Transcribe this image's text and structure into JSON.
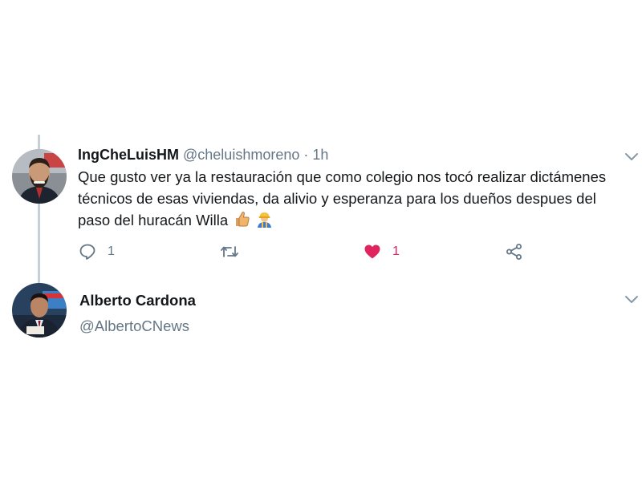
{
  "tweet": {
    "display_name": "IngCheLuisHM",
    "handle": "@cheluishmoreno",
    "separator": "·",
    "time": "1h",
    "text": "Que gusto ver ya la restauración que como colegio nos tocó realizar dictámenes técnicos de esas viviendas, da alivio y esperanza  para los dueños despues del paso del huracán Willa",
    "emojis": [
      "thumbs-up-emoji",
      "construction-worker-emoji"
    ],
    "reply_count": "1",
    "retweet_count": "",
    "like_count": "1",
    "liked": true
  },
  "reply": {
    "display_name": "Alberto Cardona",
    "handle": "@AlbertoCNews"
  },
  "colors": {
    "text_primary": "#14171a",
    "text_secondary": "#657786",
    "like_red": "#e0245e",
    "thread_line": "#c4cfd6"
  },
  "icons": [
    "reply-icon",
    "retweet-icon",
    "heart-icon",
    "share-icon",
    "chevron-down-icon"
  ]
}
